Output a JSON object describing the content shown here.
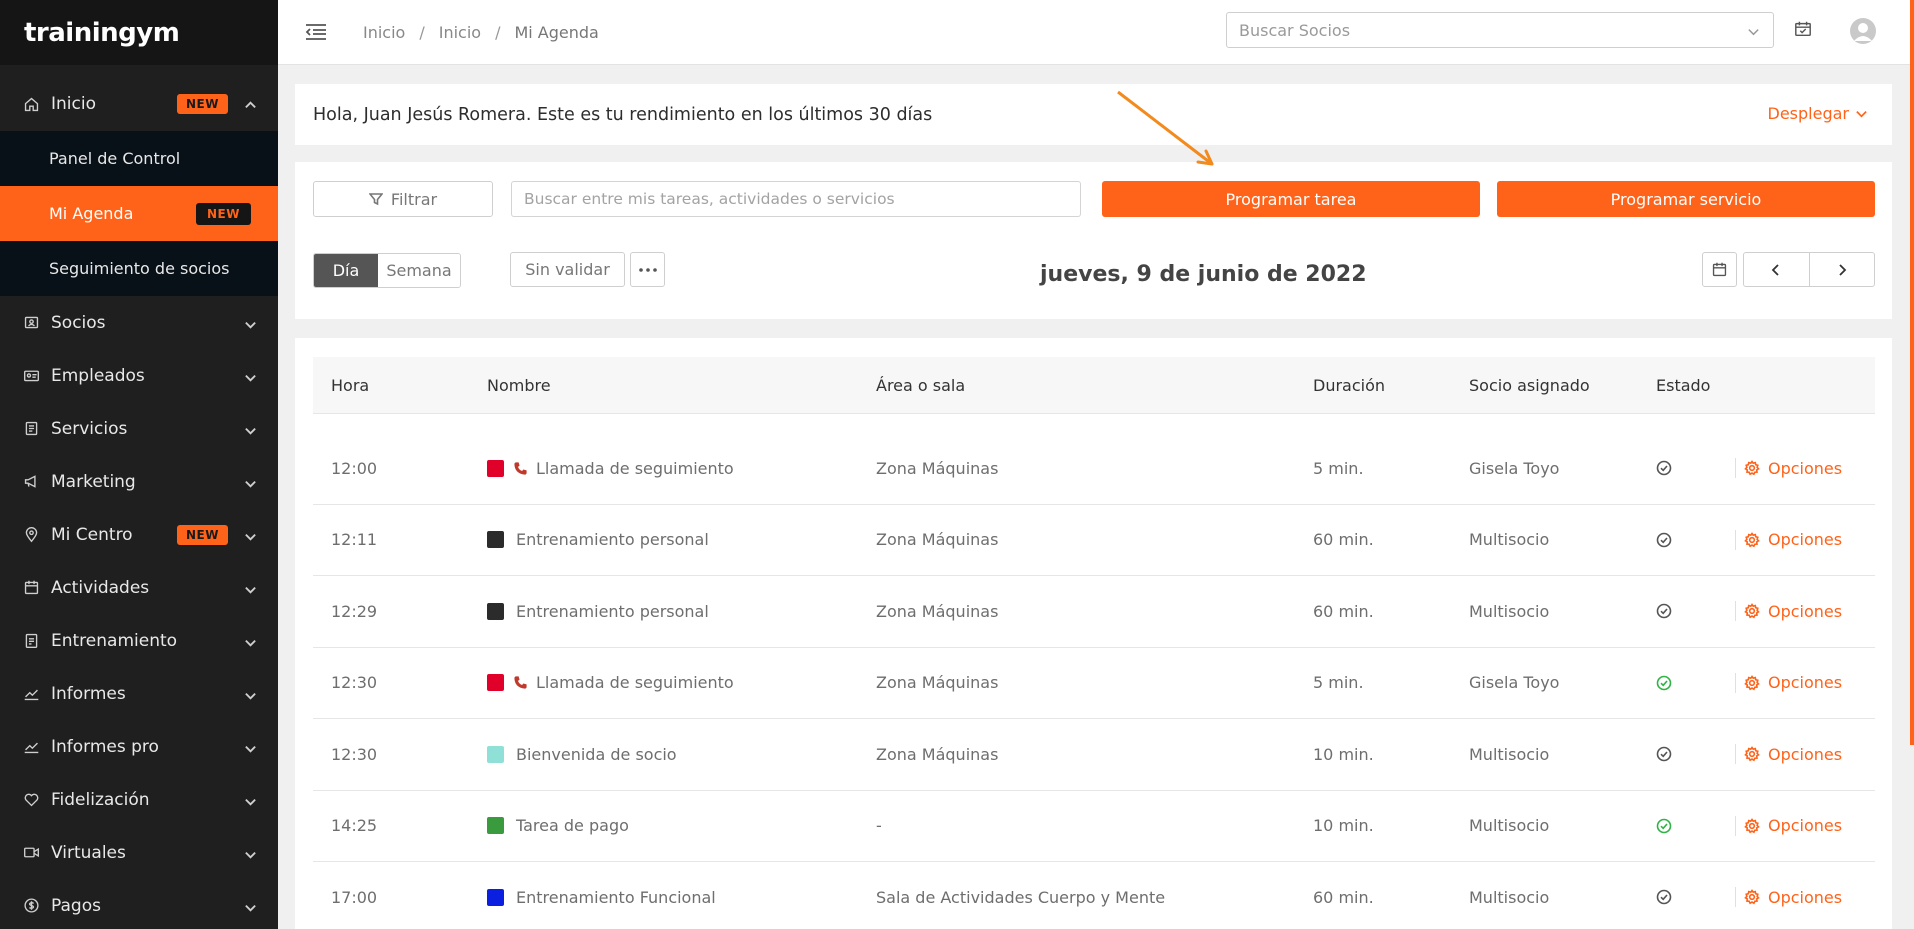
{
  "brand": {
    "logo": "trainingym"
  },
  "sidebar": {
    "items": [
      {
        "name": "inicio",
        "label": "Inicio",
        "badge": "NEW",
        "icon": "home-icon",
        "expanded": true
      },
      {
        "name": "socios",
        "label": "Socios",
        "icon": "id-card-icon"
      },
      {
        "name": "empleados",
        "label": "Empleados",
        "icon": "badge-icon"
      },
      {
        "name": "servicios",
        "label": "Servicios",
        "icon": "document-icon"
      },
      {
        "name": "marketing",
        "label": "Marketing",
        "icon": "megaphone-icon"
      },
      {
        "name": "mi-centro",
        "label": "Mi Centro",
        "badge": "NEW",
        "icon": "location-pin-icon"
      },
      {
        "name": "actividades",
        "label": "Actividades",
        "icon": "calendar-icon"
      },
      {
        "name": "entrenamiento",
        "label": "Entrenamiento",
        "icon": "clipboard-icon"
      },
      {
        "name": "informes",
        "label": "Informes",
        "icon": "chart-line-icon"
      },
      {
        "name": "informes-pro",
        "label": "Informes pro",
        "icon": "chart-line-icon"
      },
      {
        "name": "fidelizacion",
        "label": "Fidelización",
        "icon": "heart-icon"
      },
      {
        "name": "virtuales",
        "label": "Virtuales",
        "icon": "video-icon"
      },
      {
        "name": "pagos",
        "label": "Pagos",
        "icon": "coin-icon"
      }
    ],
    "subitems": [
      {
        "label": "Panel de Control"
      },
      {
        "label": "Mi Agenda",
        "badge": "NEW",
        "active": true
      },
      {
        "label": "Seguimiento de socios"
      }
    ]
  },
  "topbar": {
    "breadcrumb": [
      "Inicio",
      "Inicio",
      "Mi Agenda"
    ],
    "search_placeholder": "Buscar Socios"
  },
  "greeting": {
    "text": "Hola, Juan Jesús Romera. Este es tu rendimiento en los últimos 30 días",
    "expand_label": "Desplegar"
  },
  "controls": {
    "filter_label": "Filtrar",
    "search_placeholder": "Buscar entre mis tareas, actividades o servicios",
    "schedule_task": "Programar tarea",
    "schedule_service": "Programar servicio",
    "view_day": "Día",
    "view_week": "Semana",
    "unvalidated": "Sin validar",
    "date": "jueves, 9 de junio de 2022"
  },
  "table": {
    "headers": {
      "hora": "Hora",
      "nombre": "Nombre",
      "area": "Área o sala",
      "duracion": "Duración",
      "socio": "Socio asignado",
      "estado": "Estado"
    },
    "options_label": "Opciones",
    "rows": [
      {
        "hora": "12:00",
        "color": "#e0002a",
        "phone": true,
        "nombre": "Llamada de seguimiento",
        "area": "Zona Máquinas",
        "duracion": "5 min.",
        "socio": "Gisela Toyo",
        "estado": "pending"
      },
      {
        "hora": "12:11",
        "color": "#2b2b2b",
        "phone": false,
        "nombre": "Entrenamiento personal",
        "area": "Zona Máquinas",
        "duracion": "60 min.",
        "socio": "Multisocio",
        "estado": "pending"
      },
      {
        "hora": "12:29",
        "color": "#2b2b2b",
        "phone": false,
        "nombre": "Entrenamiento personal",
        "area": "Zona Máquinas",
        "duracion": "60 min.",
        "socio": "Multisocio",
        "estado": "pending"
      },
      {
        "hora": "12:30",
        "color": "#e0002a",
        "phone": true,
        "nombre": "Llamada de seguimiento",
        "area": "Zona Máquinas",
        "duracion": "5 min.",
        "socio": "Gisela Toyo",
        "estado": "done"
      },
      {
        "hora": "12:30",
        "color": "#8fe0d6",
        "phone": false,
        "nombre": "Bienvenida de socio",
        "area": "Zona Máquinas",
        "duracion": "10 min.",
        "socio": "Multisocio",
        "estado": "pending"
      },
      {
        "hora": "14:25",
        "color": "#3a9a3e",
        "phone": false,
        "nombre": "Tarea de pago",
        "area": "-",
        "duracion": "10 min.",
        "socio": "Multisocio",
        "estado": "done"
      },
      {
        "hora": "17:00",
        "color": "#0a1fe0",
        "phone": false,
        "nombre": "Entrenamiento Funcional",
        "area": "Sala de Actividades Cuerpo y Mente",
        "duracion": "60 min.",
        "socio": "Multisocio",
        "estado": "pending"
      }
    ]
  },
  "colors": {
    "accent": "#ff6319",
    "sidebar": "#1f1f1f",
    "done": "#2fb344",
    "pending": "#555555"
  }
}
